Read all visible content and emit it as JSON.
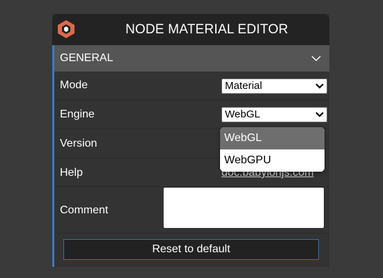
{
  "header": {
    "title": "NODE MATERIAL EDITOR",
    "logo_icon": "babylon-logo-icon"
  },
  "section": {
    "title": "GENERAL",
    "toggle_icon": "chevron-down-icon"
  },
  "rows": {
    "mode": {
      "label": "Mode",
      "value": "Material"
    },
    "engine": {
      "label": "Engine",
      "value": "WebGL"
    },
    "version": {
      "label": "Version"
    },
    "help": {
      "label": "Help",
      "link_text": "doc.babylonjs.com"
    },
    "comment": {
      "label": "Comment",
      "value": ""
    }
  },
  "dropdown": {
    "options": [
      "WebGL",
      "WebGPU"
    ],
    "selected": "WebGL"
  },
  "reset_button": {
    "label": "Reset to default"
  },
  "colors": {
    "accent": "#3a7bc0",
    "header_bg": "#232323",
    "section_bg": "#555555",
    "panel_bg": "#333333",
    "logo": "#e0684b"
  }
}
